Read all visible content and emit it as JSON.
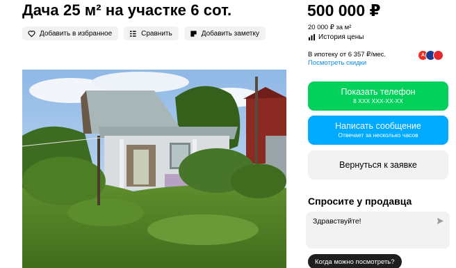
{
  "listing": {
    "title": "Дача 25 м² на участке 6 сот.",
    "price": "500 000 ₽",
    "price_per_m": "20 000 ₽ за м²",
    "price_history": "История цены"
  },
  "actions": {
    "favorite": "Добавить в избранное",
    "compare": "Сравнить",
    "note": "Добавить заметку"
  },
  "mortgage": {
    "text": "В ипотеку от 6 357 ₽/мес.",
    "discounts_link": "Посмотреть скидки",
    "bank_badges": [
      "А",
      "",
      ""
    ],
    "bank_colors": [
      "#ef3124",
      "#1b3b8f",
      "#e3282f"
    ]
  },
  "buttons": {
    "phone_label": "Показать телефон",
    "phone_sub": "8 XXX XXX-XX-XX",
    "message_label": "Написать сообщение",
    "message_sub": "Отвечает за несколько часов",
    "back_label": "Вернуться к заявке"
  },
  "ask": {
    "title": "Спросите у продавца",
    "input_value": "Здравствуйте!",
    "suggestion_chip": "Когда можно посмотреть?"
  },
  "colors": {
    "green": "#02d15c",
    "blue": "#00aaff",
    "link": "#0a8bde"
  }
}
